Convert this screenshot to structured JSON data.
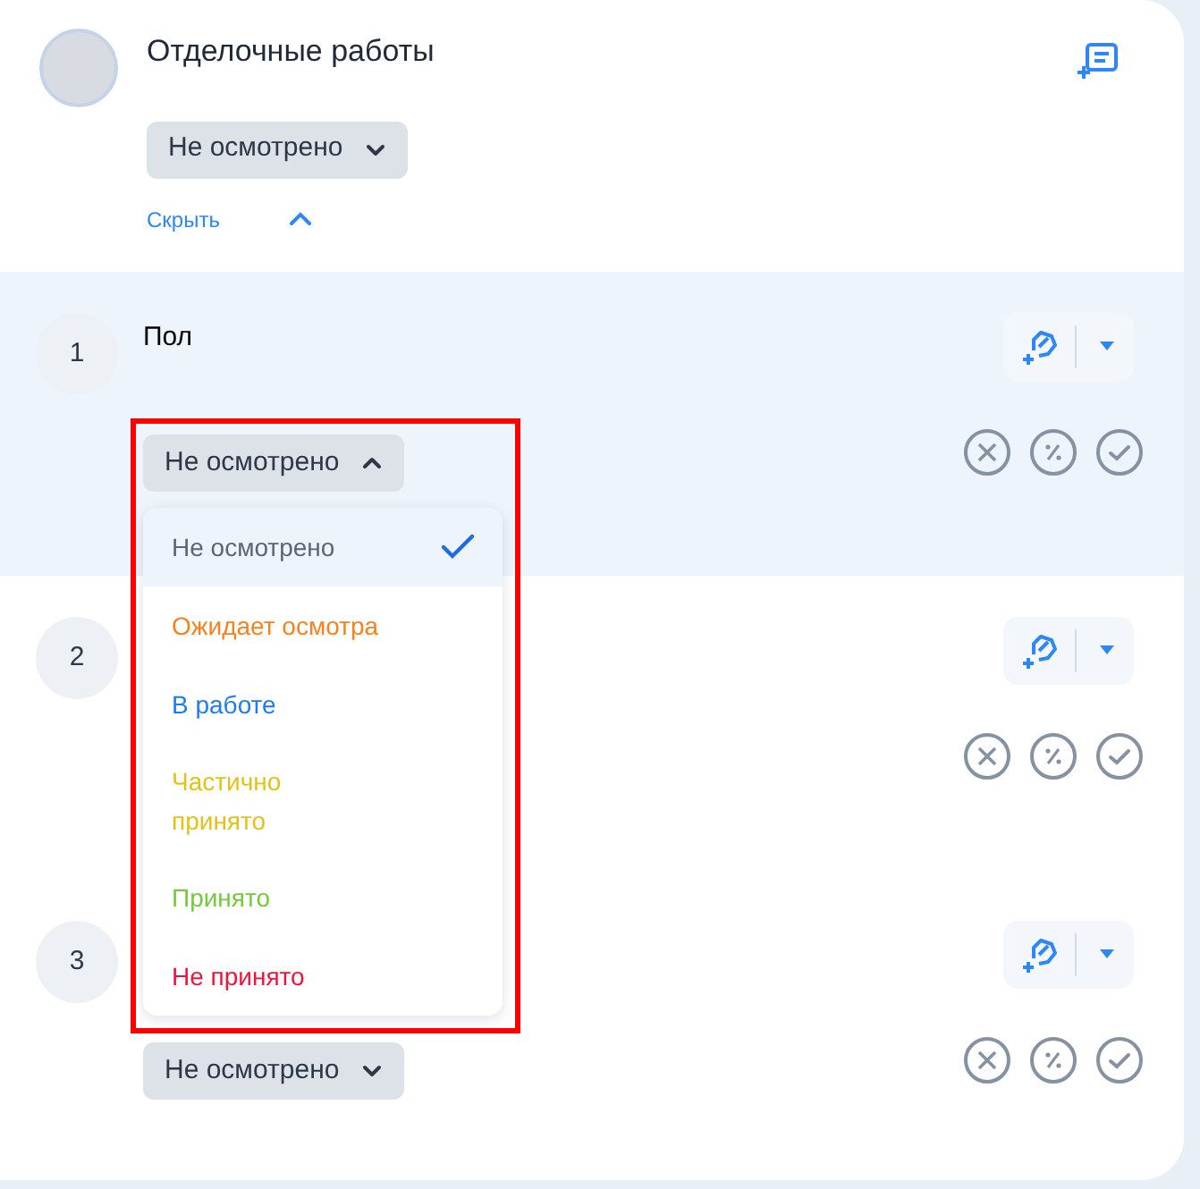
{
  "section": {
    "title": "Отделочные работы",
    "status": {
      "label": "Не осмотрено",
      "expanded": false
    },
    "toggle": {
      "label": "Скрыть",
      "expanded": true
    }
  },
  "rows": [
    {
      "number": "1",
      "name": "Пол",
      "highlighted": true,
      "status": {
        "label": "Не осмотрено",
        "expanded": true
      }
    },
    {
      "number": "2",
      "highlighted": false
    },
    {
      "number": "3",
      "highlighted": false,
      "status": {
        "label": "Не осмотрено",
        "expanded": false
      }
    }
  ],
  "status_menu": {
    "annotated": true,
    "options": [
      {
        "label": "Не осмотрено",
        "color": "#5b6573",
        "selected": true
      },
      {
        "label": "Ожидает осмотра",
        "color": "#f5821f",
        "selected": false
      },
      {
        "label": "В работе",
        "color": "#1e7bf2",
        "selected": false
      },
      {
        "label": "Частично\nпринято",
        "color": "#e2c21a",
        "selected": false
      },
      {
        "label": "Принято",
        "color": "#76c93b",
        "selected": false
      },
      {
        "label": "Не принято",
        "color": "#f0143c",
        "selected": false
      }
    ]
  }
}
